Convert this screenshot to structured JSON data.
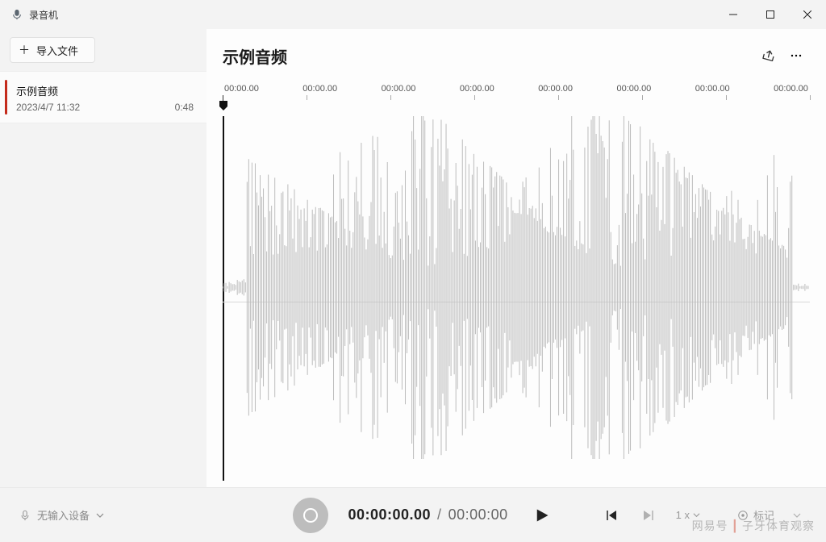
{
  "app": {
    "title": "录音机"
  },
  "window_buttons": {
    "minimize": "min",
    "maximize": "max",
    "close": "close"
  },
  "sidebar": {
    "import_label": "导入文件",
    "recordings": [
      {
        "title": "示例音频",
        "datetime": "2023/4/7 11:32",
        "duration": "0:48"
      }
    ]
  },
  "main": {
    "title": "示例音频",
    "share_icon": "share",
    "more_icon": "more",
    "timeline_labels": [
      "00:00.00",
      "00:00.00",
      "00:00.00",
      "00:00.00",
      "00:00.00",
      "00:00.00",
      "00:00.00",
      "00:00.00"
    ]
  },
  "footer": {
    "input_device": "无输入设备",
    "current_time": "00:00:00.00",
    "separator": "/",
    "total_time": "00:00:00",
    "speed_label": "1 x",
    "marker_label": "标记"
  },
  "watermark": {
    "left": "网易号",
    "right": "子牙体育观察"
  }
}
